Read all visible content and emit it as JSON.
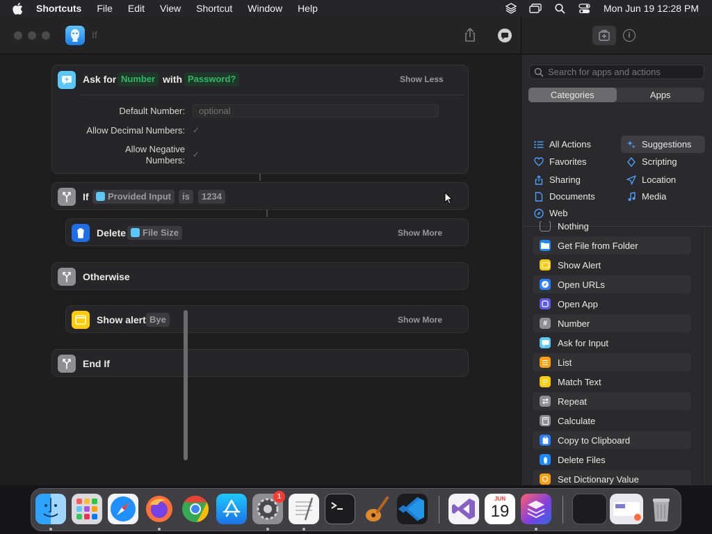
{
  "menubar": {
    "app_name": "Shortcuts",
    "menus": [
      "File",
      "Edit",
      "View",
      "Shortcut",
      "Window",
      "Help"
    ],
    "clock": "Mon Jun 19  12:28 PM"
  },
  "window": {
    "title": "If"
  },
  "editor": {
    "ask_for": {
      "word_ask": "Ask for",
      "type_token": "Number",
      "word_with": "with",
      "prompt_token": "Password?",
      "toggle": "Show Less",
      "params": {
        "default_label": "Default Number:",
        "default_placeholder": "optional",
        "decimal_label": "Allow Decimal Numbers:",
        "negative_label": "Allow Negative Numbers:"
      }
    },
    "if_block": {
      "word_if": "If",
      "input_token": "Provided Input",
      "operator_token": "is",
      "value_token": "1234"
    },
    "delete_block": {
      "title": "Delete",
      "token": "File Size",
      "toggle": "Show More"
    },
    "otherwise": {
      "title": "Otherwise"
    },
    "show_alert": {
      "title": "Show alert",
      "token": "Bye",
      "toggle": "Show More"
    },
    "end_if": {
      "title": "End If"
    }
  },
  "sidebar": {
    "search_placeholder": "Search for apps and actions",
    "tabs": [
      "Categories",
      "Apps"
    ],
    "active_tab": "Categories",
    "categories_left": [
      {
        "label": "All Actions",
        "icon": "list-icon"
      },
      {
        "label": "Favorites",
        "icon": "heart-icon"
      },
      {
        "label": "Sharing",
        "icon": "share-icon"
      },
      {
        "label": "Documents",
        "icon": "document-icon"
      },
      {
        "label": "Web",
        "icon": "compass-icon"
      }
    ],
    "categories_right": [
      {
        "label": "Suggestions",
        "icon": "sparkle-icon",
        "selected": true
      },
      {
        "label": "Scripting",
        "icon": "scripting-icon"
      },
      {
        "label": "Location",
        "icon": "location-arrow-icon"
      },
      {
        "label": "Media",
        "icon": "music-note-icon"
      }
    ],
    "actions": [
      {
        "label": "Nothing",
        "color": "#6e6e72",
        "glyph": ""
      },
      {
        "label": "Get File from Folder",
        "color": "#1e88ff",
        "glyph": ""
      },
      {
        "label": "Show Alert",
        "color": "#ffcc00",
        "glyph": ""
      },
      {
        "label": "Open URLs",
        "color": "#2a7fff",
        "glyph": ""
      },
      {
        "label": "Open App",
        "color": "#5e5ce6",
        "glyph": ""
      },
      {
        "label": "Number",
        "color": "#8e8e93",
        "glyph": "#"
      },
      {
        "label": "Ask for Input",
        "color": "#5ac8fa",
        "glyph": ""
      },
      {
        "label": "List",
        "color": "#ff9f0a",
        "glyph": ""
      },
      {
        "label": "Match Text",
        "color": "#ffcc00",
        "glyph": ""
      },
      {
        "label": "Repeat",
        "color": "#8e8e93",
        "glyph": ""
      },
      {
        "label": "Calculate",
        "color": "#8e8e93",
        "glyph": ""
      },
      {
        "label": "Copy to Clipboard",
        "color": "#2a7fff",
        "glyph": ""
      },
      {
        "label": "Delete Files",
        "color": "#1e88ff",
        "glyph": ""
      },
      {
        "label": "Set Dictionary Value",
        "color": "#ff9f0a",
        "glyph": ""
      }
    ]
  },
  "dock": {
    "apps": [
      "Finder",
      "Launchpad",
      "Safari",
      "Firefox",
      "Chrome",
      "App Store",
      "System Settings",
      "TextEdit",
      "Terminal",
      "GarageBand",
      "VS Code",
      "Visual Studio",
      "Calendar",
      "Shortcuts",
      "Preview Window",
      "Screenshot",
      "Trash"
    ],
    "settings_badge": "1",
    "calendar_month": "JUN",
    "calendar_day": "19"
  }
}
